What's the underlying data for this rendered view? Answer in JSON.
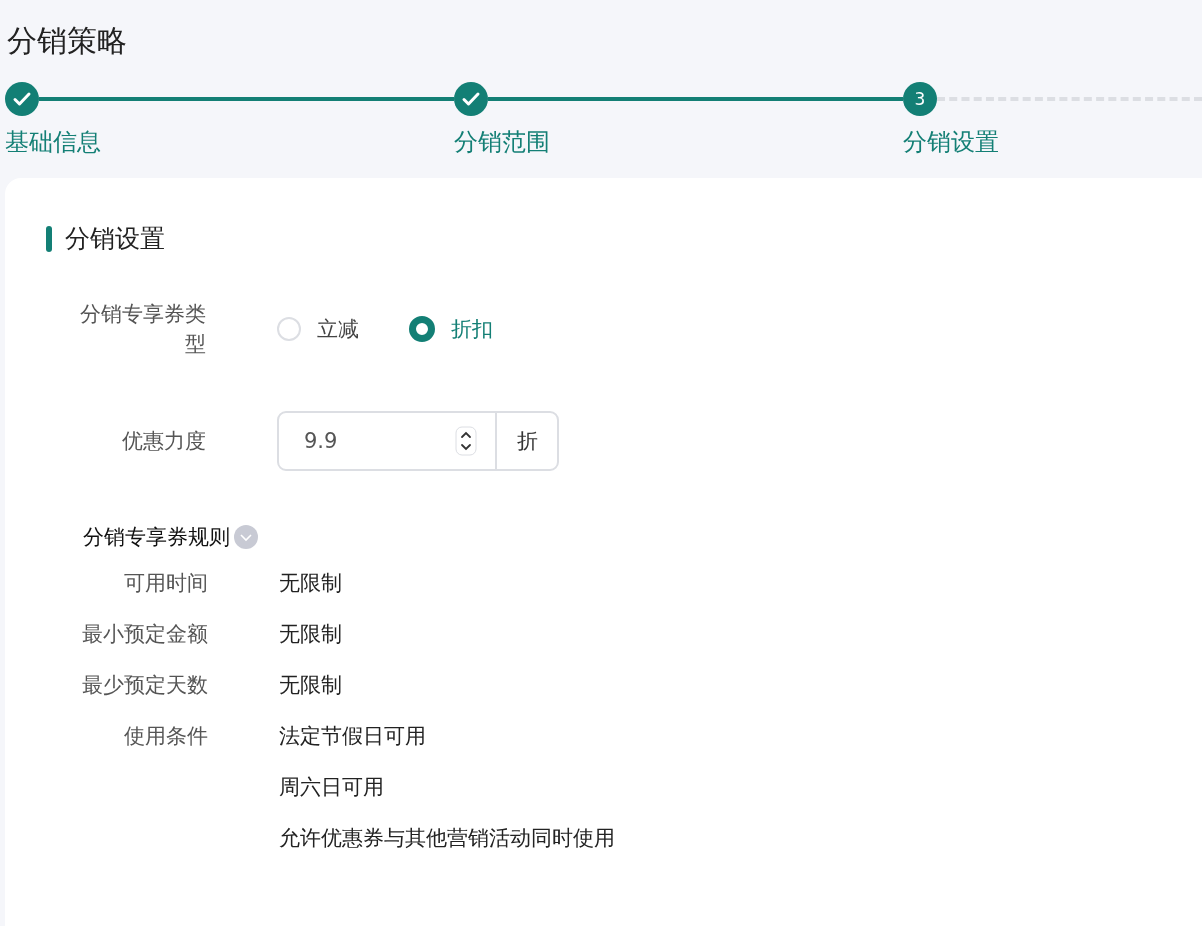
{
  "page_title": "分销策略",
  "steps": [
    {
      "label": "基础信息",
      "kind": "done"
    },
    {
      "label": "分销范围",
      "kind": "done"
    },
    {
      "label": "分销设置",
      "kind": "current",
      "number": "3"
    }
  ],
  "section_title": "分销设置",
  "coupon_type": {
    "label": "分销专享券类型",
    "options": [
      {
        "label": "立减",
        "selected": false
      },
      {
        "label": "折扣",
        "selected": true
      }
    ]
  },
  "discount": {
    "label": "优惠力度",
    "value": "9.9",
    "unit": "折"
  },
  "rules_title": "分销专享券规则",
  "rules": [
    {
      "label": "可用时间",
      "values": [
        "无限制"
      ]
    },
    {
      "label": "最小预定金额",
      "values": [
        "无限制"
      ]
    },
    {
      "label": "最少预定天数",
      "values": [
        "无限制"
      ]
    },
    {
      "label": "使用条件",
      "values": [
        "法定节假日可用",
        "周六日可用",
        "允许优惠券与其他营销活动同时使用"
      ]
    }
  ]
}
